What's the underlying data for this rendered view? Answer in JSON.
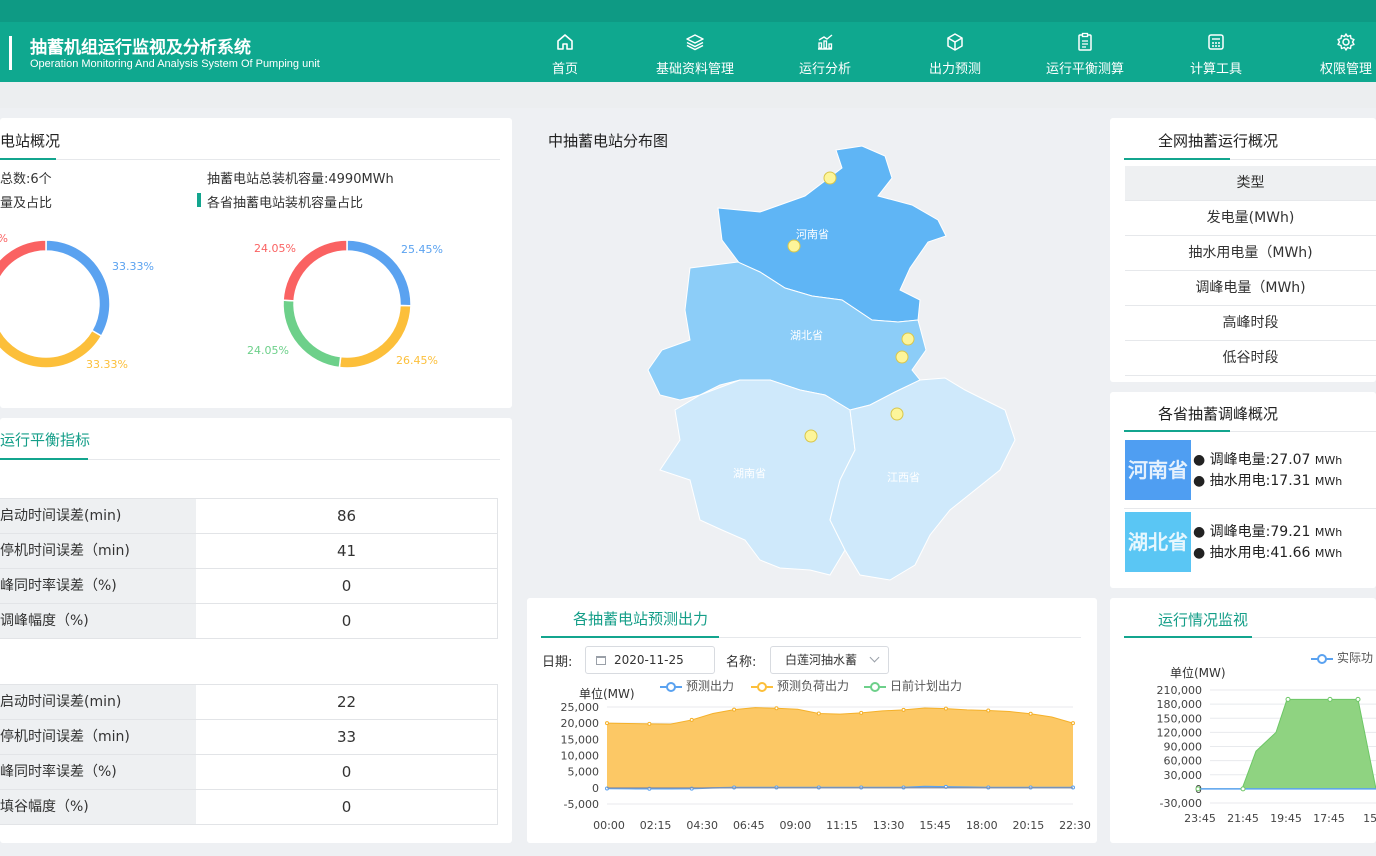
{
  "app": {
    "title": "抽蓄机组运行监视及分析系统",
    "subtitle": "Operation Monitoring And Analysis System Of Pumping unit"
  },
  "nav": [
    {
      "label": "首页",
      "icon": "home-icon"
    },
    {
      "label": "基础资料管理",
      "icon": "layers-icon"
    },
    {
      "label": "运行分析",
      "icon": "chart-icon"
    },
    {
      "label": "出力预测",
      "icon": "cube-icon"
    },
    {
      "label": "运行平衡测算",
      "icon": "clipboard-icon"
    },
    {
      "label": "计算工具",
      "icon": "calculator-icon"
    },
    {
      "label": "权限管理",
      "icon": "gear-icon"
    }
  ],
  "overview": {
    "title": "电站概况",
    "count_text": "总数:6个",
    "capacity_text": "抽蓄电站总装机容量:4990MWh",
    "left_sub": "量及占比",
    "right_sub": "各省抽蓄电站装机容量占比"
  },
  "donut_left": {
    "type": "pie",
    "labels": [
      "33.33%",
      "33.33%",
      "%"
    ],
    "values": [
      33.33,
      33.33,
      33.33
    ],
    "colors": [
      "#5aa2f0",
      "#fcbf3a",
      "#fa6262"
    ]
  },
  "donut_right": {
    "type": "pie",
    "labels": [
      "25.45%",
      "26.45%",
      "24.05%",
      "24.05%"
    ],
    "values": [
      25.45,
      26.45,
      24.05,
      24.05
    ],
    "colors": [
      "#5aa2f0",
      "#fcbf3a",
      "#6dd08a",
      "#fa6262"
    ]
  },
  "balance": {
    "title": "运行平衡指标",
    "group1": [
      {
        "label": "启动时间误差(min)",
        "value": "86"
      },
      {
        "label": "停机时间误差（min)",
        "value": "41"
      },
      {
        "label": "峰同时率误差（%)",
        "value": "0"
      },
      {
        "label": "调峰幅度（%)",
        "value": "0"
      }
    ],
    "group2": [
      {
        "label": "启动时间误差(min)",
        "value": "22"
      },
      {
        "label": "停机时间误差（min)",
        "value": "33"
      },
      {
        "label": "峰同时率误差（%)",
        "value": "0"
      },
      {
        "label": "填谷幅度（%)",
        "value": "0"
      }
    ]
  },
  "map": {
    "title": "中抽蓄电站分布图",
    "provinces": [
      "河南省",
      "湖北省",
      "湖南省",
      "江西省"
    ]
  },
  "grid": {
    "title": "全网抽蓄运行概况",
    "header": "类型",
    "rows": [
      "发电量(MWh)",
      "抽水用电量（MWh)",
      "调峰电量（MWh)",
      "高峰时段",
      "低谷时段"
    ]
  },
  "province_peak": {
    "title": "各省抽蓄调峰概况",
    "items": [
      {
        "name": "河南省",
        "color": "#4f9ef2",
        "peak": "调峰电量:27.07",
        "pump": "抽水用电:17.31",
        "unit": "MWh"
      },
      {
        "name": "湖北省",
        "color": "#5ac6f4",
        "peak": "调峰电量:79.21",
        "pump": "抽水用电:41.66",
        "unit": "MWh"
      }
    ]
  },
  "forecast": {
    "title": "各抽蓄电站预测出力",
    "date_label": "日期:",
    "date_value": "2020-11-25",
    "name_label": "名称:",
    "name_value": "白莲河抽水蓄",
    "unit": "单位(MW)",
    "legend": [
      "预测出力",
      "预测负荷出力",
      "日前计划出力"
    ]
  },
  "chart_data": [
    {
      "type": "area",
      "title": "",
      "ylabel": "单位(MW)",
      "ylim": [
        -5000,
        25000
      ],
      "yticks": [
        "25,000",
        "20,000",
        "15,000",
        "10,000",
        "5,000",
        "0",
        "-5,000"
      ],
      "xticks": [
        "00:00",
        "02:15",
        "04:30",
        "06:45",
        "09:00",
        "11:15",
        "13:30",
        "15:45",
        "18:00",
        "20:15",
        "22:30"
      ],
      "series": [
        {
          "name": "预测负荷出力",
          "color": "#fcbf3a",
          "values": [
            20000,
            19900,
            19800,
            19700,
            21000,
            23000,
            24200,
            24800,
            24600,
            24300,
            23000,
            22800,
            23200,
            23800,
            24100,
            24700,
            24500,
            24100,
            23900,
            23600,
            22900,
            21900,
            20000
          ]
        },
        {
          "name": "预测出力",
          "color": "#5aa2f0",
          "values": [
            -200,
            -250,
            -300,
            -280,
            -250,
            0,
            100,
            100,
            100,
            100,
            100,
            100,
            100,
            100,
            100,
            400,
            300,
            200,
            100,
            100,
            100,
            100,
            100
          ]
        },
        {
          "name": "日前计划出力",
          "color": "#6dd08a",
          "values": []
        }
      ]
    },
    {
      "type": "area",
      "title": "",
      "ylabel": "单位(MW)",
      "ylim": [
        -30000,
        210000
      ],
      "yticks": [
        "210,000",
        "180,000",
        "150,000",
        "120,000",
        "90,000",
        "60,000",
        "30,000",
        "0",
        "-30,000"
      ],
      "xticks": [
        "23:45",
        "21:45",
        "19:45",
        "17:45",
        "15:"
      ],
      "series": [
        {
          "name": "实际功",
          "color": "#5aa2f0",
          "values": [
            0,
            0,
            0,
            0,
            0,
            0,
            0
          ]
        },
        {
          "name": "",
          "color": "#6dd08a",
          "values": [
            0,
            0,
            0,
            80000,
            120000,
            190000,
            190000,
            190000,
            0
          ]
        }
      ]
    }
  ],
  "monitor": {
    "title": "运行情况监视",
    "unit": "单位(MW)",
    "legend": "实际功"
  }
}
